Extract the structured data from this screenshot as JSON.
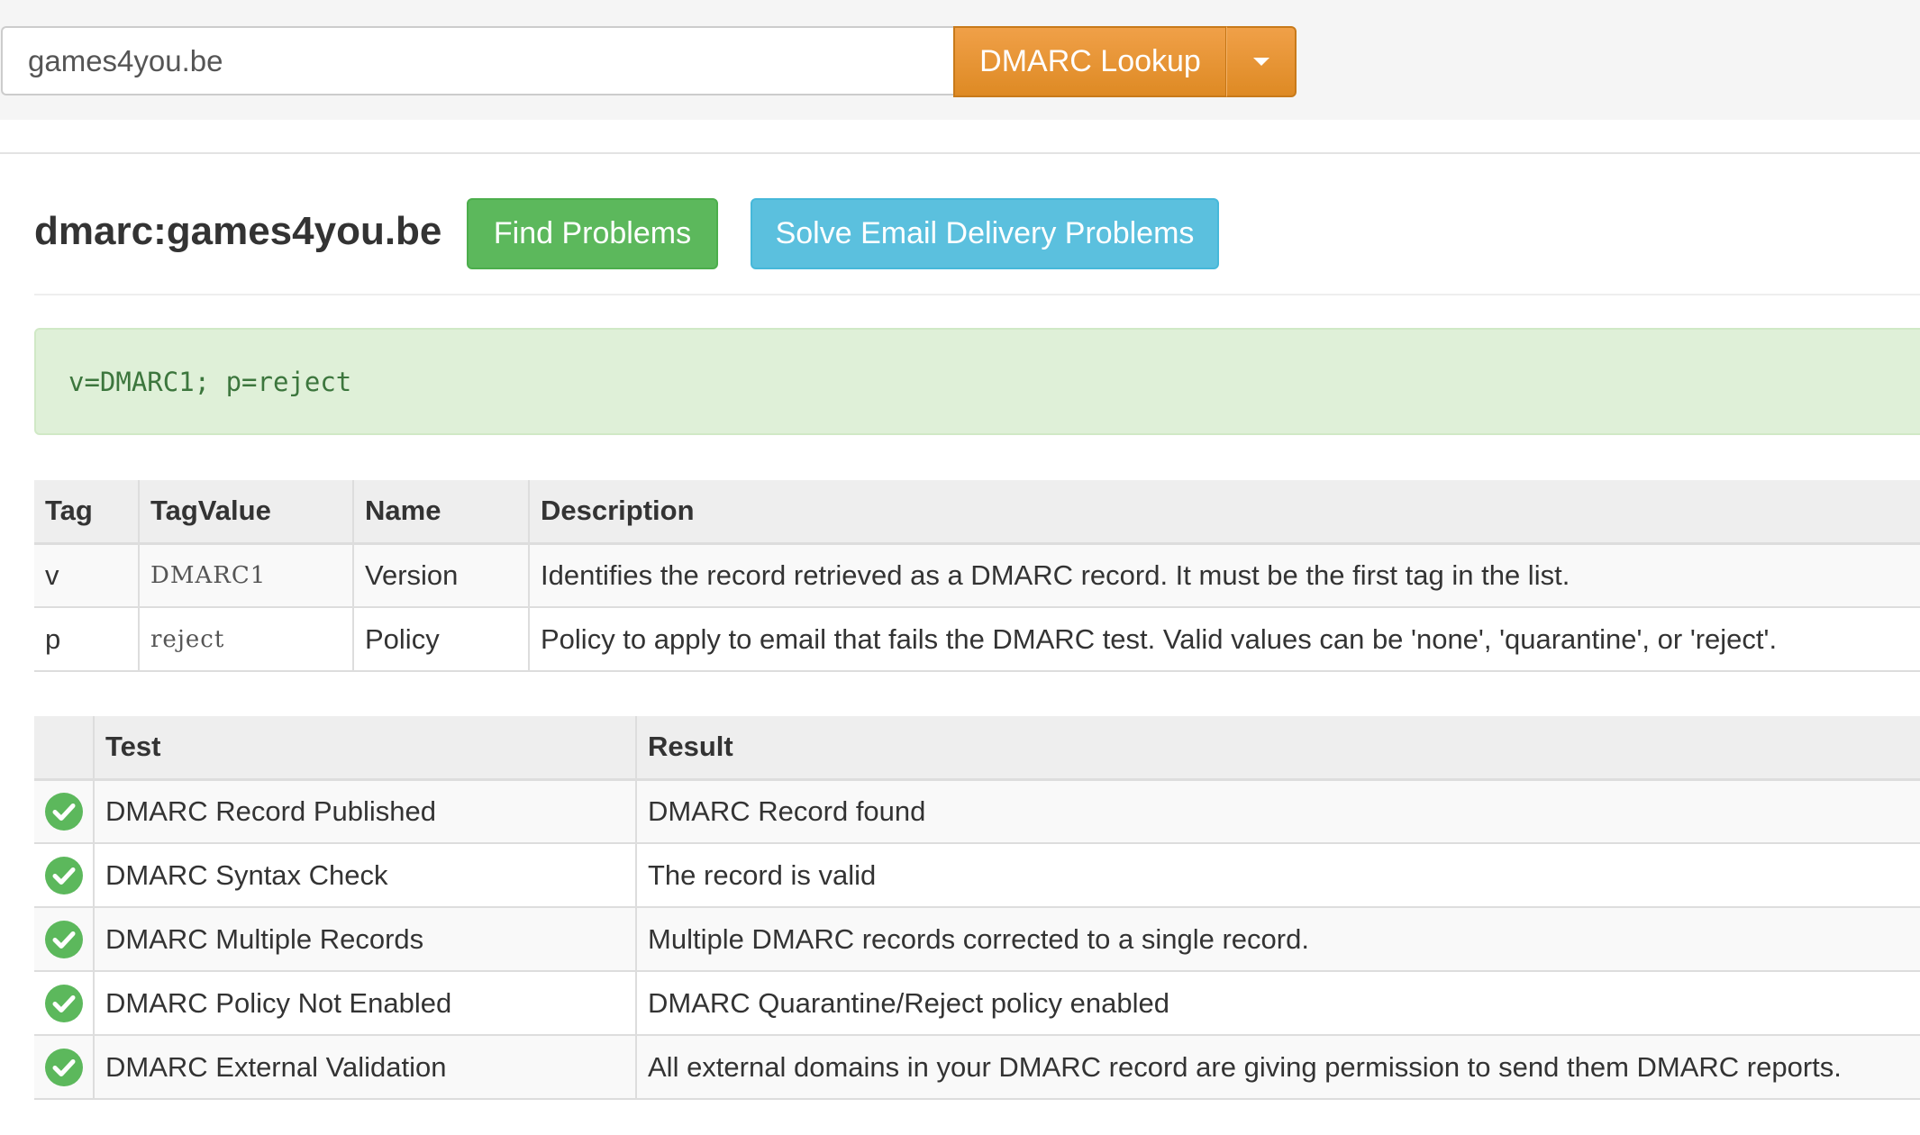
{
  "search": {
    "value": "games4you.be",
    "button_label": "DMARC Lookup"
  },
  "header": {
    "title": "dmarc:games4you.be",
    "find_problems_label": "Find Problems",
    "solve_problems_label": "Solve Email Delivery Problems"
  },
  "record": {
    "text": "v=DMARC1; p=reject"
  },
  "tag_table": {
    "headers": [
      "Tag",
      "TagValue",
      "Name",
      "Description"
    ],
    "rows": [
      {
        "tag": "v",
        "value": "DMARC1",
        "name": "Version",
        "description": "Identifies the record retrieved as a DMARC record. It must be the first tag in the list."
      },
      {
        "tag": "p",
        "value": "reject",
        "name": "Policy",
        "description": "Policy to apply to email that fails the DMARC test. Valid values can be 'none', 'quarantine', or 'reject'."
      }
    ]
  },
  "test_table": {
    "headers": [
      "",
      "Test",
      "Result"
    ],
    "rows": [
      {
        "status_icon": "check-circle-icon",
        "test": "DMARC Record Published",
        "result": "DMARC Record found"
      },
      {
        "status_icon": "check-circle-icon",
        "test": "DMARC Syntax Check",
        "result": "The record is valid"
      },
      {
        "status_icon": "check-circle-icon",
        "test": "DMARC Multiple Records",
        "result": "Multiple DMARC records corrected to a single record."
      },
      {
        "status_icon": "check-circle-icon",
        "test": "DMARC Policy Not Enabled",
        "result": "DMARC Quarantine/Reject policy enabled"
      },
      {
        "status_icon": "check-circle-icon",
        "test": "DMARC External Validation",
        "result": "All external domains in your DMARC record are giving permission to send them DMARC reports."
      }
    ]
  },
  "colors": {
    "lookup_button": "#e8902e",
    "find_button": "#5cb85c",
    "solve_button": "#5bc0de",
    "record_background": "#dff0d8",
    "record_text": "#3c763d",
    "status_ok": "#5cb85c"
  }
}
